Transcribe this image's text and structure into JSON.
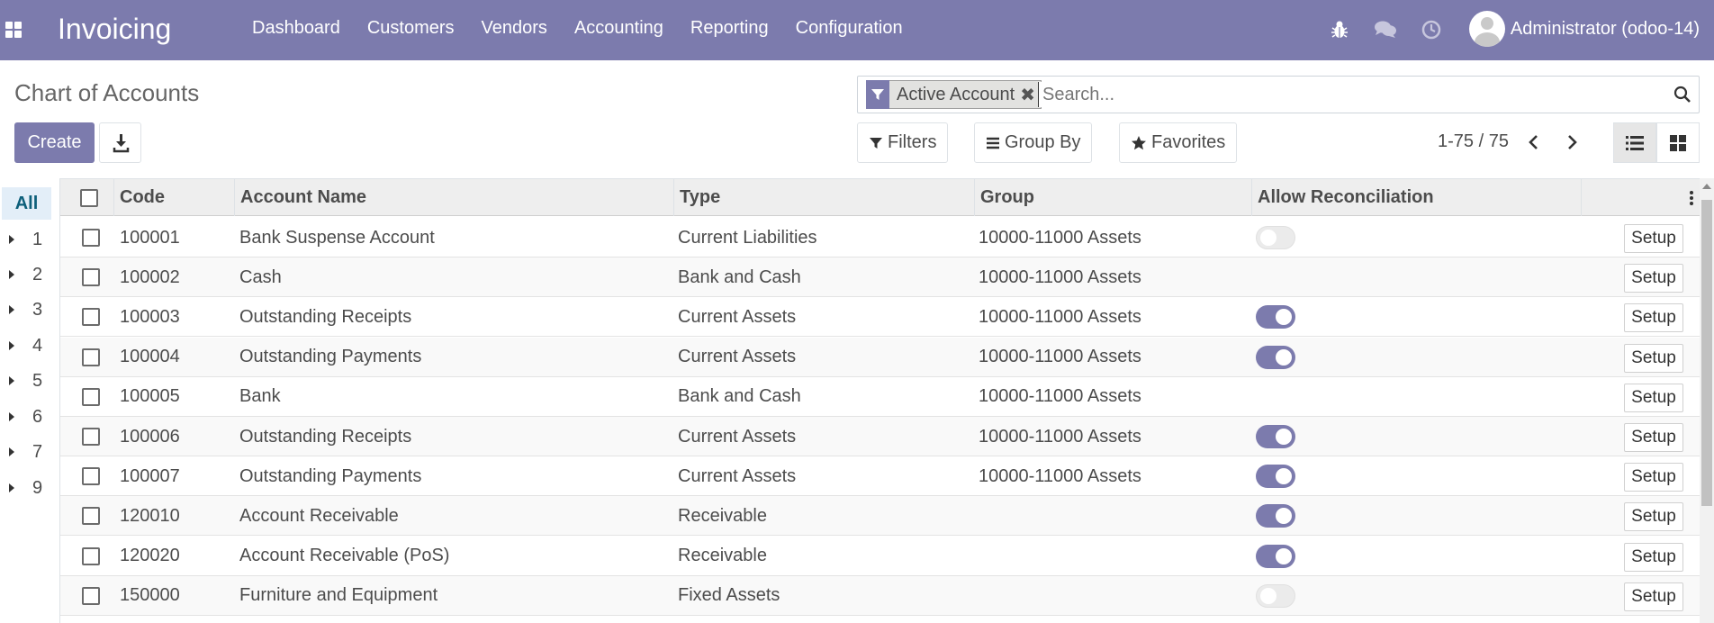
{
  "navbar": {
    "brand": "Invoicing",
    "menu": [
      "Dashboard",
      "Customers",
      "Vendors",
      "Accounting",
      "Reporting",
      "Configuration"
    ],
    "icons": [
      "bug-icon",
      "chat-icon",
      "clock-icon"
    ],
    "user_name": "Administrator (odoo-14)",
    "color": "#7c7bad"
  },
  "control_panel": {
    "title": "Chart of Accounts",
    "create_label": "Create",
    "search": {
      "facet_label": "Active Account",
      "placeholder": "Search..."
    },
    "filters_label": "Filters",
    "group_by_label": "Group By",
    "favorites_label": "Favorites",
    "pager": "1-75 / 75"
  },
  "search_panel": {
    "all_label": "All",
    "items": [
      "1",
      "2",
      "3",
      "4",
      "5",
      "6",
      "7",
      "9"
    ]
  },
  "table": {
    "columns": [
      "Code",
      "Account Name",
      "Type",
      "Group",
      "Allow Reconciliation"
    ],
    "setup_label": "Setup",
    "rows": [
      {
        "code": "100001",
        "name": "Bank Suspense Account",
        "type": "Current Liabilities",
        "group": "10000-11000 Assets",
        "reconcile": "off"
      },
      {
        "code": "100002",
        "name": "Cash",
        "type": "Bank and Cash",
        "group": "10000-11000 Assets",
        "reconcile": "none"
      },
      {
        "code": "100003",
        "name": "Outstanding Receipts",
        "type": "Current Assets",
        "group": "10000-11000 Assets",
        "reconcile": "on"
      },
      {
        "code": "100004",
        "name": "Outstanding Payments",
        "type": "Current Assets",
        "group": "10000-11000 Assets",
        "reconcile": "on"
      },
      {
        "code": "100005",
        "name": "Bank",
        "type": "Bank and Cash",
        "group": "10000-11000 Assets",
        "reconcile": "none"
      },
      {
        "code": "100006",
        "name": "Outstanding Receipts",
        "type": "Current Assets",
        "group": "10000-11000 Assets",
        "reconcile": "on"
      },
      {
        "code": "100007",
        "name": "Outstanding Payments",
        "type": "Current Assets",
        "group": "10000-11000 Assets",
        "reconcile": "on"
      },
      {
        "code": "120010",
        "name": "Account Receivable",
        "type": "Receivable",
        "group": "",
        "reconcile": "on"
      },
      {
        "code": "120020",
        "name": "Account Receivable (PoS)",
        "type": "Receivable",
        "group": "",
        "reconcile": "on"
      },
      {
        "code": "150000",
        "name": "Furniture and Equipment",
        "type": "Fixed Assets",
        "group": "",
        "reconcile": "off"
      }
    ]
  }
}
